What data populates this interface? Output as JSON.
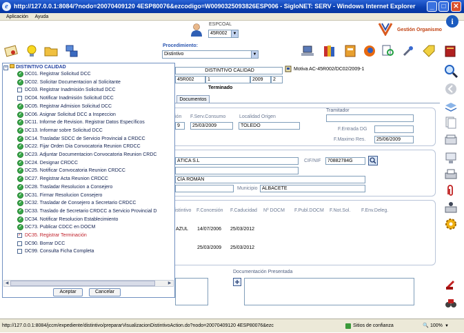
{
  "window": {
    "title": "http://127.0.0.1:8084/?nodo=20070409120 4ESP80076&ezcodigo=W0090325093826ESP006 - SigloNET: SERV - Windows Internet Explorer",
    "minimize": "_",
    "maximize": "□",
    "close": "✕"
  },
  "menu": [
    "Aplicación",
    "Ayuda"
  ],
  "header": {
    "espcoal_label": "ESPCOAL",
    "espcoal_value": "45R002",
    "gestion_label": "Gestión Organismo",
    "info": "i"
  },
  "toolbar": {
    "procedimiento_label": "Procedimiento:",
    "procedimiento_value": "Distintivo"
  },
  "record": {
    "title": "DISTINTIVO CALIDAD",
    "code": "45R002",
    "num": "1",
    "year": "2009",
    "seq": "2",
    "status": "Terminado",
    "motiva": "Motiva AC-45R002/DC02/2009-1"
  },
  "tabs": {
    "documentos": "Documentos"
  },
  "form": {
    "col_fragment": "ión",
    "f_serv_consumo_label": "F.Serv.Consumo",
    "f_serv_consumo": "25/03/2009",
    "localidad_origen_label": "Localidad Origen",
    "localidad_origen": "TOLEDO",
    "date_fragment": "9",
    "tramitador_label": "Tramitador",
    "tramitador": "",
    "f_entrada_dg_label": "F.Entrada DG",
    "f_entrada_dg": "",
    "f_maximo_res_label": "F.Maximo Res.",
    "f_maximo_res": "25/06/2009",
    "empresa": "ÁTICA S.L",
    "cif_label": "CIF/NIF",
    "cif": "70882784G",
    "persona": "CÍA ROMÁN",
    "municipio_label": "Municipio",
    "municipio": "ALBACETE"
  },
  "distintivos": {
    "headers": [
      "istintivo",
      "F.Concesión",
      "F.Caducidad",
      "Nº DOCM",
      "F.Publ.DOCM",
      "F.Not.Sol.",
      "F.Env.Deleg."
    ],
    "rows": [
      {
        "name": "AZUL",
        "concesion": "14/07/2006",
        "caducidad": "25/03/2012"
      },
      {
        "name": "",
        "concesion": "25/03/2009",
        "caducidad": "25/03/2012"
      }
    ]
  },
  "documentacion_label": "Documentación Presentada",
  "popup": {
    "root": "DISTINTIVO CALIDAD",
    "items": [
      {
        "label": "DC01. Registrar Solicitud DCC",
        "kind": "done"
      },
      {
        "label": "DC02. Solicitar Documentacion al Solicitante",
        "kind": "done"
      },
      {
        "label": "DC03. Registrar Inadmisión Solicitud DCC",
        "kind": "box"
      },
      {
        "label": "DC04. Notificar Inadmisión Solicitud DCC",
        "kind": "box"
      },
      {
        "label": "DC05. Registrar Admision Solicitud DCC",
        "kind": "done"
      },
      {
        "label": "DC06. Asignar Solicitud DCC a Inspeccion",
        "kind": "done"
      },
      {
        "label": "DC11. Informe de Revision. Registrar Datos Específicos",
        "kind": "done"
      },
      {
        "label": "DC13. Informar sobre Solicitud DCC",
        "kind": "done"
      },
      {
        "label": "DC14. Trasladar SDCC de Servicio Provincial a CRDCC",
        "kind": "done"
      },
      {
        "label": "DC22. Fijar Orden Dia Convocatoria Reunion CRDCC",
        "kind": "done"
      },
      {
        "label": "DC23. Adjuntar Documentacion Convocatoria Reunion CRDC",
        "kind": "done"
      },
      {
        "label": "DC24. Designar CRDCC",
        "kind": "done"
      },
      {
        "label": "DC25. Notificar Convocatoria Reunion CRDCC",
        "kind": "done"
      },
      {
        "label": "DC27. Registrar Acta Reunion CRDCC",
        "kind": "done"
      },
      {
        "label": "DC28. Trasladar Resolucion a Consejero",
        "kind": "done"
      },
      {
        "label": "DC31. Firmar Resolucion Consejero",
        "kind": "done"
      },
      {
        "label": "DC32. Trasladar de Consejero a Secretario CRDCC",
        "kind": "done"
      },
      {
        "label": "DC33. Traslado de Secretario CRDCC a Servicio Provincial D",
        "kind": "done"
      },
      {
        "label": "DC34. Notificar Resolucion Establecimiento",
        "kind": "done"
      },
      {
        "label": "DC73. Publicar CDCC en DOCM",
        "kind": "done"
      },
      {
        "label": "DC35. Registrar Terminación",
        "kind": "checked"
      },
      {
        "label": "DC90. Borrar DCC",
        "kind": "box"
      },
      {
        "label": "DC99. Consulta Ficha Completa",
        "kind": "box"
      }
    ],
    "accept": "Aceptar",
    "cancel": "Cancelar"
  },
  "status": {
    "url": "http://127.0.0.1:8084/jccm/expediente/distintivo/prepararVisualizacionDistintivoAction.do?nodo=20070409120 4ESP80076&ezc",
    "zone": "Sitios de confianza",
    "zoom": "100%"
  }
}
